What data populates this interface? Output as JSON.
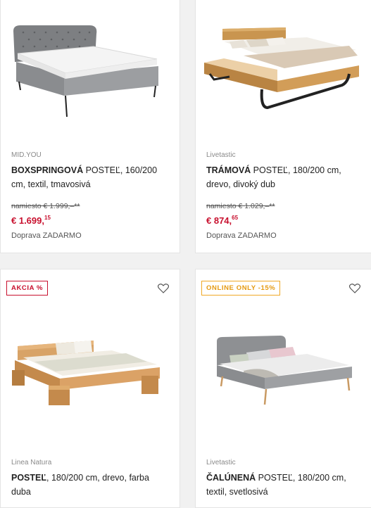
{
  "products": [
    {
      "brand": "MID.YOU",
      "title_bold": "BOXSPRINGOVÁ",
      "title_rest": " POSTEĽ, 160/200 cm, textil, tmavosivá",
      "old_price": "namiesto € 1.999,–**",
      "price_main": "€ 1.699,",
      "price_cents": "15",
      "shipping": "Doprava ZADARMO"
    },
    {
      "brand": "Livetastic",
      "title_bold": "TRÁMOVÁ",
      "title_rest": " POSTEĽ, 180/200 cm, drevo, divoký dub",
      "old_price": "namiesto € 1.029,–**",
      "price_main": "€ 874,",
      "price_cents": "65",
      "shipping": "Doprava ZADARMO"
    },
    {
      "badge": "AKCIA %",
      "brand": "Linea Natura",
      "title_bold": "POSTEĽ",
      "title_rest": ", 180/200 cm, drevo, farba duba"
    },
    {
      "badge": "ONLINE ONLY -15%",
      "brand": "Livetastic",
      "title_bold": "ČALÚNENÁ",
      "title_rest": " POSTEĽ, 180/200 cm, textil, svetlosivá"
    }
  ],
  "colors": {
    "price": "#c8102e",
    "badge_sale": "#c8102e",
    "badge_online": "#f0a825"
  },
  "icons": {
    "wishlist": "heart-icon"
  }
}
